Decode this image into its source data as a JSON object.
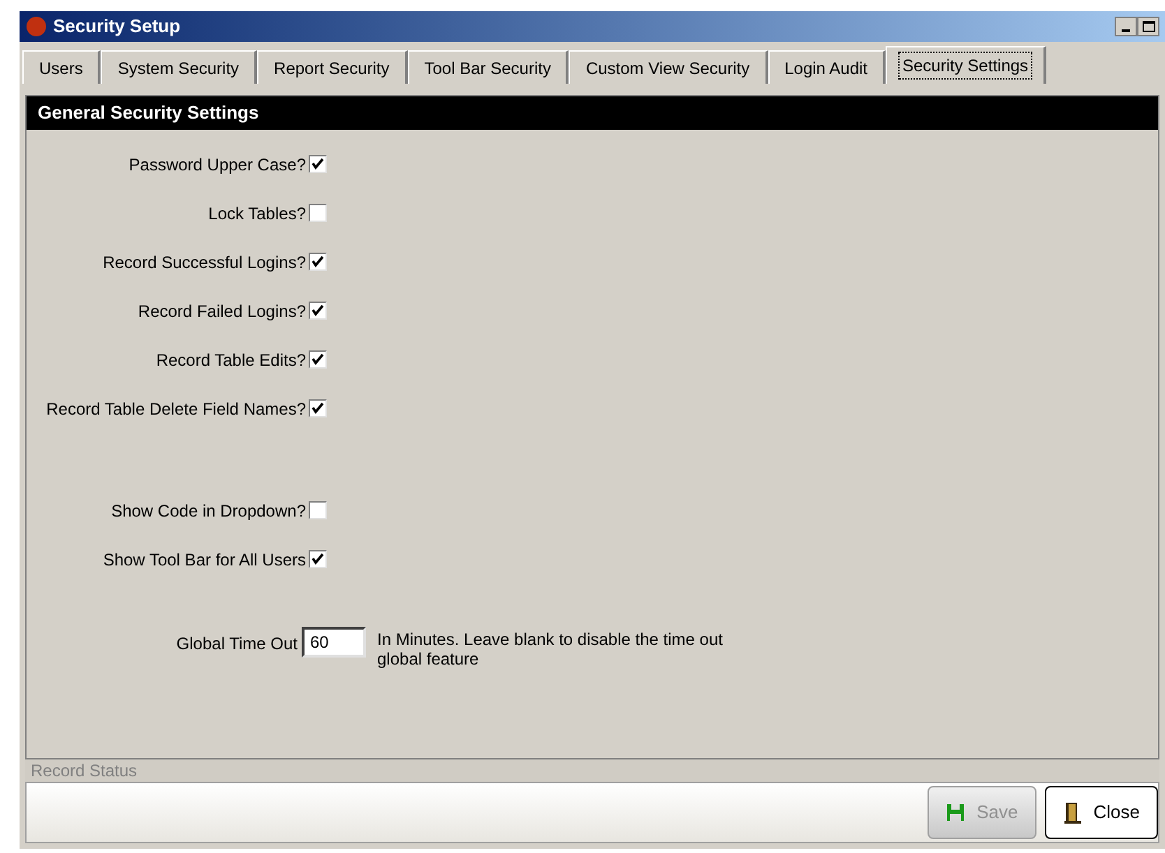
{
  "window": {
    "title": "Security Setup"
  },
  "tabs": [
    {
      "label": "Users",
      "selected": false
    },
    {
      "label": "System Security",
      "selected": false
    },
    {
      "label": "Report Security",
      "selected": false
    },
    {
      "label": "Tool Bar Security",
      "selected": false
    },
    {
      "label": "Custom View Security",
      "selected": false
    },
    {
      "label": "Login Audit",
      "selected": false
    },
    {
      "label": "Security Settings",
      "selected": true
    }
  ],
  "section": {
    "title": "General Security Settings"
  },
  "settings": [
    {
      "label": "Password Upper Case?",
      "checked": true
    },
    {
      "label": "Lock Tables?",
      "checked": false
    },
    {
      "label": "Record Successful Logins?",
      "checked": true
    },
    {
      "label": "Record Failed Logins?",
      "checked": true
    },
    {
      "label": "Record Table Edits?",
      "checked": true
    },
    {
      "label": "Record Table Delete Field Names?",
      "checked": true
    },
    {
      "label": "Show Code in Dropdown?",
      "checked": false
    },
    {
      "label": "Show Tool Bar for All Users",
      "checked": true
    }
  ],
  "timeout": {
    "label": "Global Time Out",
    "value": "60",
    "hint": "In Minutes.  Leave blank to disable the time out global feature"
  },
  "status_bar": {
    "label": "Record Status"
  },
  "buttons": [
    {
      "kind": "save",
      "label": "Save",
      "disabled": true
    },
    {
      "kind": "close",
      "label": "Close",
      "disabled": false
    }
  ]
}
